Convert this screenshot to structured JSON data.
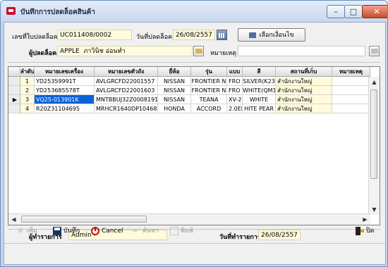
{
  "window": {
    "title": "บันทึกการปลดล็อคสินค้า",
    "minimize": "–",
    "maximize": "□",
    "close": "✕"
  },
  "header": {
    "doc_no_label": "เลขที่ใบปลดล็อค",
    "doc_no_value": "UC011408/0002",
    "date_label": "วันที่ปลดล็อค",
    "date_value": "26/08/2557",
    "select_button": "เลือกเงื่อนไข",
    "unlocker_label": "ผู้ปลดล็อค",
    "unlocker_code": "APPLE",
    "unlocker_name": "ภาวินิช อ่อนทำ",
    "remark_label": "หมายเหตุ",
    "remark_value": ""
  },
  "grid": {
    "columns": [
      "ลำดับ",
      "หมายเลขเครื่อง",
      "หมายเลขตัวถัง",
      "ยี่ห้อ",
      "รุ่น",
      "แบบ",
      "สี",
      "สถานที่เก็บ",
      "หมายเหตุ"
    ],
    "rows": [
      {
        "no": "1",
        "engine": "YD25359991T",
        "chassis": "AVLGRCFD22001557",
        "brand": "NISSAN",
        "model": "FRONTIER N",
        "type": "FRO",
        "color": "SILVER(K23",
        "location": "สำนักงานใหญ่",
        "remark": ""
      },
      {
        "no": "2",
        "engine": "YD253685578T",
        "chassis": "AVLGRCFD22001603",
        "brand": "NISSAN",
        "model": "FRONTIER N",
        "type": "FRO",
        "color": "WHITE(QM1",
        "location": "สำนักงานใหญ่",
        "remark": ""
      },
      {
        "no": "3",
        "engine": "VQ25-013901K",
        "chassis": "MNTBBUJ32Z0008191",
        "brand": "NISSAN",
        "model": "TEANA",
        "type": "XV-2",
        "color": "WHITE",
        "location": "สำนักงานใหญ่",
        "remark": ""
      },
      {
        "no": "4",
        "engine": "R20Z31104695",
        "chassis": "MRHCR1640DP10468",
        "brand": "HONDA",
        "model": "ACCORD",
        "type": "2.0EL",
        "color": "HITE PEAR",
        "location": "สำนักงานใหญ่",
        "remark": ""
      }
    ],
    "current_row_marker": "▶"
  },
  "footer": {
    "operator_label": "ผู้ทำรายการ",
    "operator_value": "Admin -",
    "op_date_label": "วันที่ทำรายการ",
    "op_date_value": "26/08/2557"
  },
  "toolbar": {
    "add": "เพิ่ม",
    "save": "บันทึก",
    "cancel": "Cancel",
    "search": "ค้นหา",
    "print": "พิมพ์",
    "exit": "ปิด"
  },
  "icons": {
    "add": "plus-icon",
    "search": "binoculars-icon",
    "print": "printer-icon"
  },
  "colors": {
    "field_bg": "#fffbdc",
    "selection": "#0b61d8",
    "window_frame": "#c4d5ec"
  }
}
